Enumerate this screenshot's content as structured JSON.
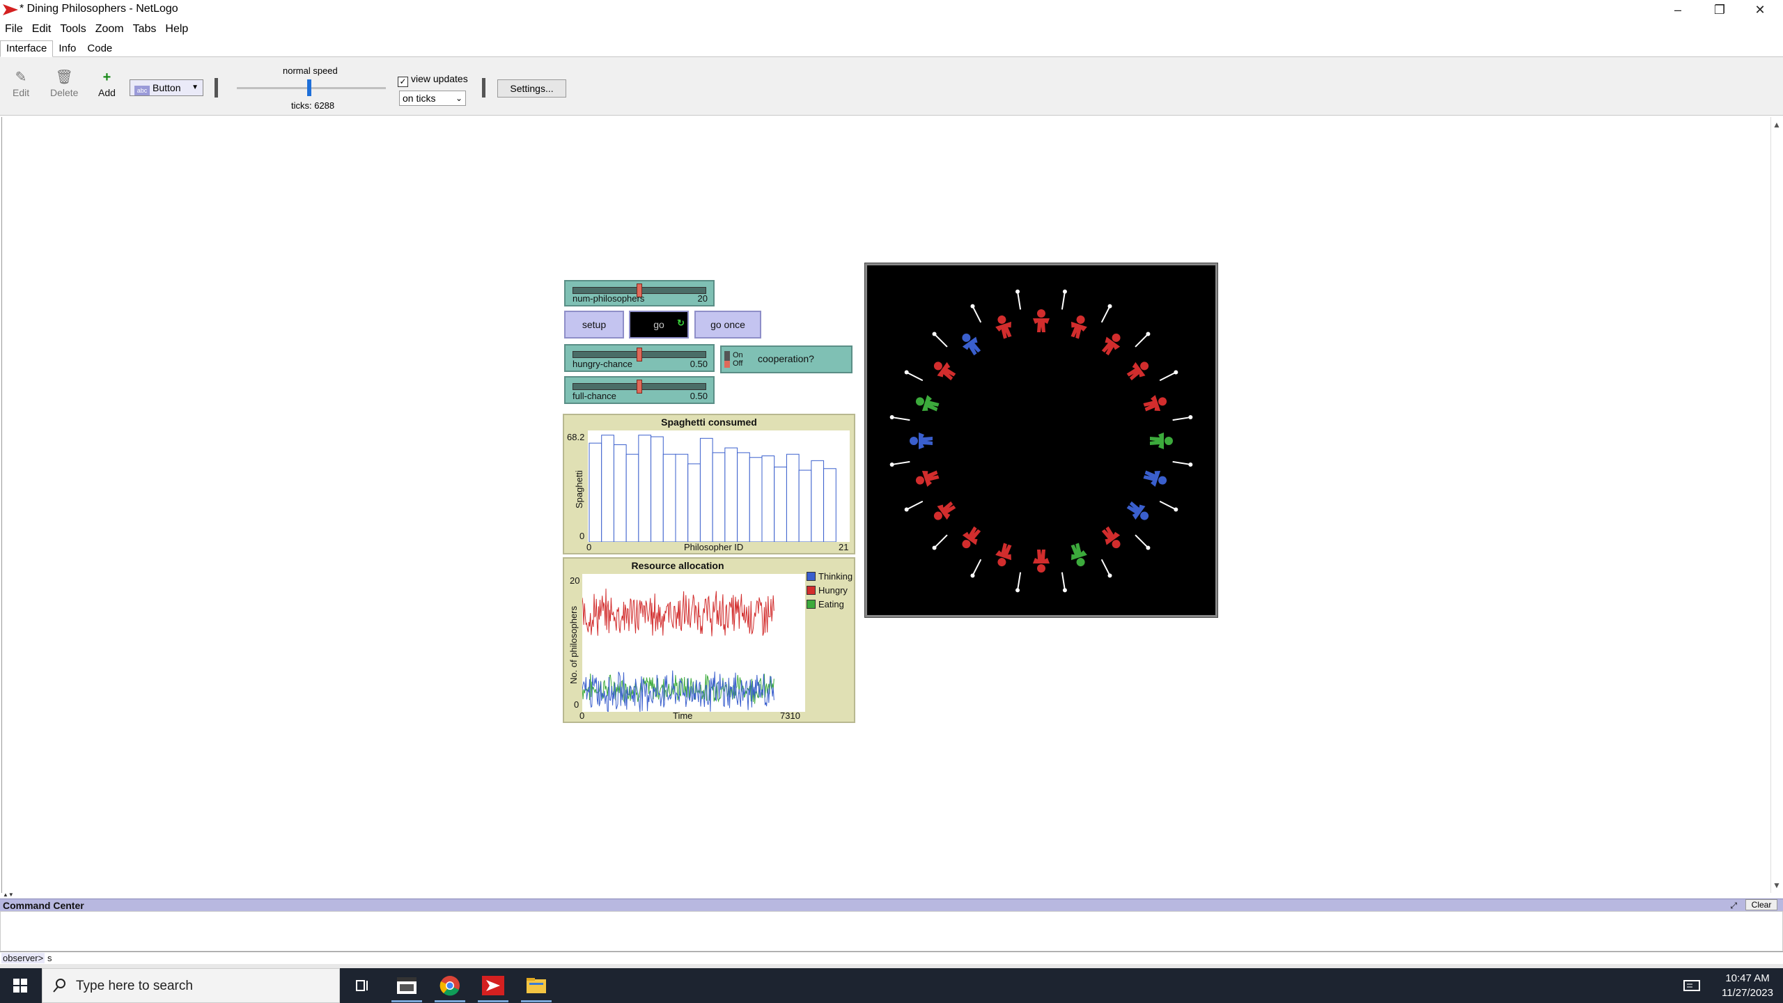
{
  "window": {
    "title": "* Dining Philosophers - NetLogo"
  },
  "menu": [
    "File",
    "Edit",
    "Tools",
    "Zoom",
    "Tabs",
    "Help"
  ],
  "tabs": [
    "Interface",
    "Info",
    "Code"
  ],
  "toolbar": {
    "edit": "Edit",
    "delete": "Delete",
    "add": "Add",
    "widget_type": "Button",
    "speed_label": "normal speed",
    "ticks": "ticks: 6288",
    "view_updates": "view updates",
    "update_mode": "on ticks",
    "settings": "Settings..."
  },
  "widgets": {
    "num_philosophers": {
      "label": "num-philosophers",
      "value": "20",
      "fraction": 0.5
    },
    "setup": "setup",
    "go": "go",
    "go_once": "go once",
    "hungry_chance": {
      "label": "hungry-chance",
      "value": "0.50",
      "fraction": 0.5
    },
    "full_chance": {
      "label": "full-chance",
      "value": "0.50",
      "fraction": 0.5
    },
    "cooperation": {
      "label": "cooperation?",
      "on": "On",
      "off": "Off",
      "state": "Off"
    }
  },
  "chart_data": [
    {
      "type": "bar",
      "title": "Spaghetti consumed",
      "xlabel": "Philosopher ID",
      "ylabel": "Spaghetti",
      "xlim": [
        0,
        21
      ],
      "ylim": [
        0,
        68.2
      ],
      "x_tick_labels": [
        "0",
        "21"
      ],
      "y_tick_labels": [
        "0",
        "68.2"
      ],
      "categories": [
        0,
        1,
        2,
        3,
        4,
        5,
        6,
        7,
        8,
        9,
        10,
        11,
        12,
        13,
        14,
        15,
        16,
        17,
        18,
        19
      ],
      "values": [
        62,
        67,
        61,
        55,
        67,
        66,
        55,
        55,
        49,
        65,
        56,
        59,
        56,
        53,
        54,
        47,
        55,
        45,
        51,
        46
      ]
    },
    {
      "type": "line",
      "title": "Resource allocation",
      "xlabel": "Time",
      "ylabel": "No. of philosophers",
      "xlim": [
        0,
        7310
      ],
      "ylim": [
        0,
        20
      ],
      "x_tick_labels": [
        "0",
        "7310"
      ],
      "y_tick_labels": [
        "0",
        "20"
      ],
      "x_max_data": 6288,
      "series": [
        {
          "name": "Thinking",
          "color": "#3a5fcd",
          "mean": 3,
          "spread": 2.2
        },
        {
          "name": "Hungry",
          "color": "#d22d2d",
          "mean": 14.5,
          "spread": 2.6
        },
        {
          "name": "Eating",
          "color": "#3caa3c",
          "mean": 3.5,
          "spread": 1.6
        }
      ]
    }
  ],
  "world": {
    "philosophers": [
      "red",
      "red",
      "red",
      "red",
      "red",
      "green",
      "blue",
      "blue",
      "red",
      "green",
      "red",
      "red",
      "red",
      "red",
      "red",
      "blue",
      "green",
      "red",
      "blue",
      "red"
    ]
  },
  "command_center": {
    "title": "Command Center",
    "clear": "Clear",
    "observer": "observer>",
    "input": "s"
  },
  "taskbar": {
    "search_placeholder": "Type here to search",
    "time": "10:47 AM",
    "date": "11/27/2023"
  },
  "colors": {
    "red": "#d22d2d",
    "green": "#3caa3c",
    "blue": "#3a5fcd"
  }
}
